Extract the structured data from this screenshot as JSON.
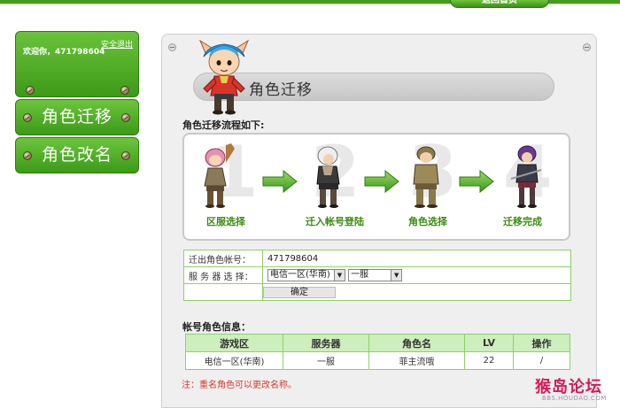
{
  "header": {
    "tab_label": "返回首页"
  },
  "sidebar": {
    "welcome": "欢迎你，471798604",
    "logout": "安全退出",
    "menu": [
      {
        "label": "角色迁移"
      },
      {
        "label": "角色改名"
      }
    ]
  },
  "panel": {
    "title": "角色迁移",
    "flow_title": "角色迁移流程如下:",
    "steps": [
      {
        "num": "1",
        "label": "区服选择"
      },
      {
        "num": "2",
        "label": "迁入帐号登陆"
      },
      {
        "num": "3",
        "label": "角色选择"
      },
      {
        "num": "4",
        "label": "迁移完成"
      }
    ]
  },
  "form": {
    "account_label": "迁出角色帐号：",
    "account_value": "471798604",
    "server_label": "服 务 器 选 择：",
    "region_selected": "电信一区(华南)",
    "server_selected": "一服",
    "submit_label": "确定"
  },
  "info": {
    "title": "帐号角色信息：",
    "columns": [
      "游戏区",
      "服务器",
      "角色名",
      "LV",
      "操作"
    ],
    "rows": [
      [
        "电信一区(华南)",
        "一服",
        "菲主流哦",
        "22",
        "/"
      ]
    ],
    "note": "注：重名角色可以更改名称。"
  },
  "watermark": {
    "text": "猴岛论坛",
    "sub": "BBS.HOUDAO.COM"
  },
  "colors": {
    "brand_green": "#4a9c1e",
    "table_border": "#8fd06a",
    "note_red": "#d8372d"
  }
}
